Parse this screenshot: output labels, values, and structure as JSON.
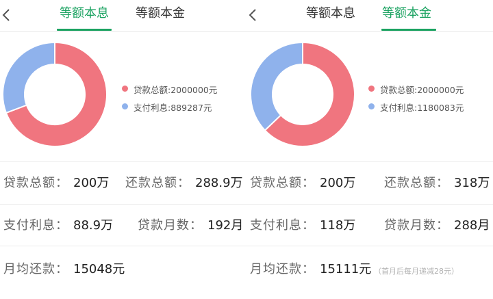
{
  "left": {
    "tabs": [
      "等额本息",
      "等额本金"
    ],
    "active_tab": 0,
    "chart_data": {
      "type": "pie",
      "categories": [
        "贷款总额",
        "支付利息"
      ],
      "values": [
        2000000,
        889287
      ],
      "colors": [
        "#f0757f",
        "#8fb2ec"
      ]
    },
    "legend": [
      "贷款总额:2000000元",
      "支付利息:889287元"
    ],
    "rows": [
      {
        "label1": "贷款总额：",
        "value1": "200万",
        "label2": "还款总额：",
        "value2": "288.9万"
      },
      {
        "label1": "支付利息：",
        "value1": "88.9万",
        "label2": "贷款月数：",
        "value2": "192月"
      },
      {
        "label1": "月均还款：",
        "value1": "15048元"
      }
    ]
  },
  "right": {
    "tabs": [
      "等额本息",
      "等额本金"
    ],
    "active_tab": 1,
    "chart_data": {
      "type": "pie",
      "categories": [
        "贷款总额",
        "支付利息"
      ],
      "values": [
        2000000,
        1180083
      ],
      "colors": [
        "#f0757f",
        "#8fb2ec"
      ]
    },
    "legend": [
      "贷款总额:2000000元",
      "支付利息:1180083元"
    ],
    "rows": [
      {
        "label1": "贷款总额：",
        "value1": "200万",
        "label2": "还款总额：",
        "value2": "318万"
      },
      {
        "label1": "支付利息：",
        "value1": "118万",
        "label2": "贷款月数：",
        "value2": "288月"
      },
      {
        "label1": "月均还款：",
        "value1": "15111元",
        "note": "（首月后每月递减28元）"
      }
    ]
  },
  "icons": {
    "back": "chevron-left-icon"
  },
  "colors": {
    "accent": "#1aa260",
    "principal": "#f0757f",
    "interest": "#8fb2ec"
  }
}
